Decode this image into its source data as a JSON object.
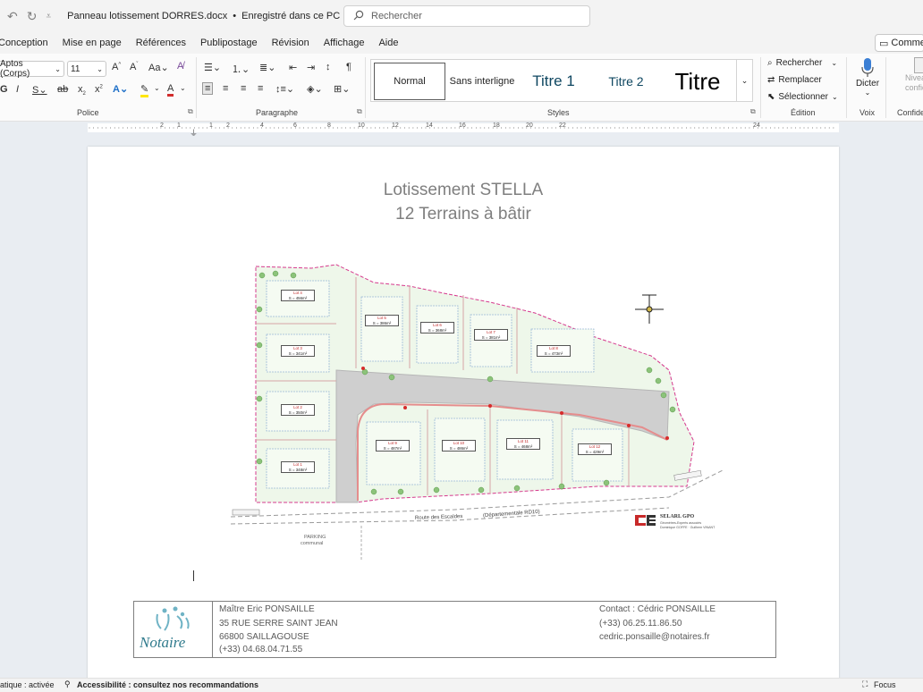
{
  "titlebar": {
    "filename": "Panneau lotissement DORRES.docx",
    "separator": "•",
    "save_status": "Enregistré dans ce PC",
    "search_placeholder": "Rechercher"
  },
  "menu": {
    "tabs": [
      "Conception",
      "Mise en page",
      "Références",
      "Publipostage",
      "Révision",
      "Affichage",
      "Aide"
    ],
    "comment_label": "Commentaires"
  },
  "ribbon": {
    "font": {
      "name": "Aptos (Corps)",
      "size": "11",
      "group_label": "Police"
    },
    "paragraph": {
      "group_label": "Paragraphe"
    },
    "styles": {
      "group_label": "Styles",
      "items": [
        "Normal",
        "Sans interligne",
        "Titre 1",
        "Titre 2",
        "Titre"
      ]
    },
    "editing": {
      "group_label": "Édition",
      "find": "Rechercher",
      "replace": "Remplacer",
      "select": "Sélectionner"
    },
    "voice": {
      "dictate": "Dicter",
      "group_label": "Voix"
    },
    "confidentiality": {
      "label": "Niveau de confidentialité",
      "group_label": "Confidentialité"
    }
  },
  "ruler": {
    "numbers": [
      "2",
      "1",
      "1",
      "2",
      "4",
      "6",
      "8",
      "10",
      "12",
      "14",
      "16",
      "18",
      "20",
      "22",
      "24"
    ]
  },
  "document": {
    "title_line1": "Lotissement STELLA",
    "title_line2": "12 Terrains à bâtir",
    "plan": {
      "lots": [
        {
          "name": "Lot 4",
          "area": "S = 456m²"
        },
        {
          "name": "Lot 3",
          "area": "S = 341m²"
        },
        {
          "name": "Lot 2",
          "area": "S = 350m²"
        },
        {
          "name": "Lot 1",
          "area": "S = 348m²"
        },
        {
          "name": "Lot 5",
          "area": "S = 386m²"
        },
        {
          "name": "Lot 6",
          "area": "S = 368m²"
        },
        {
          "name": "Lot 7",
          "area": "S = 381m²"
        },
        {
          "name": "Lot 8",
          "area": "S = 473m²"
        },
        {
          "name": "Lot 9",
          "area": "S = 487m²"
        },
        {
          "name": "Lot 10",
          "area": "S = 486m²"
        },
        {
          "name": "Lot 11",
          "area": "S = 468m²"
        },
        {
          "name": "Lot 12",
          "area": "S = 429m²"
        }
      ],
      "road_label": "Route des Escaldes",
      "road_sub": "(Départementale RD10)",
      "parking_label": "PARKING",
      "parking_sub": "communal",
      "surveyor_name": "SELARL GPO",
      "surveyor_line": "Géomètres-Experts associés",
      "surveyor_line2": "Dominique GOFFE · Guilhem VINANT"
    },
    "contact_card": {
      "logo_text": "Notaire",
      "notary_name": "Maître Eric PONSAILLE",
      "address1": "35 RUE SERRE SAINT JEAN",
      "address2": "66800 SAILLAGOUSE",
      "phone": "(+33) 04.68.04.71.55",
      "contact_label": "Contact : Cédric PONSAILLE",
      "contact_phone": "(+33) 06.25.11.86.50",
      "contact_email": "cedric.ponsaille@notaires.fr"
    }
  },
  "statusbar": {
    "autosave": "atique : activée",
    "accessibility": "Accessibilité : consultez nos recommandations",
    "focus": "Focus"
  },
  "colors": {
    "lot_fill": "#eaf6e6",
    "lot_border": "#d6a5a5",
    "boundary": "#d63a8e",
    "road": "#c8c8c8",
    "accent": "#0f4761"
  }
}
